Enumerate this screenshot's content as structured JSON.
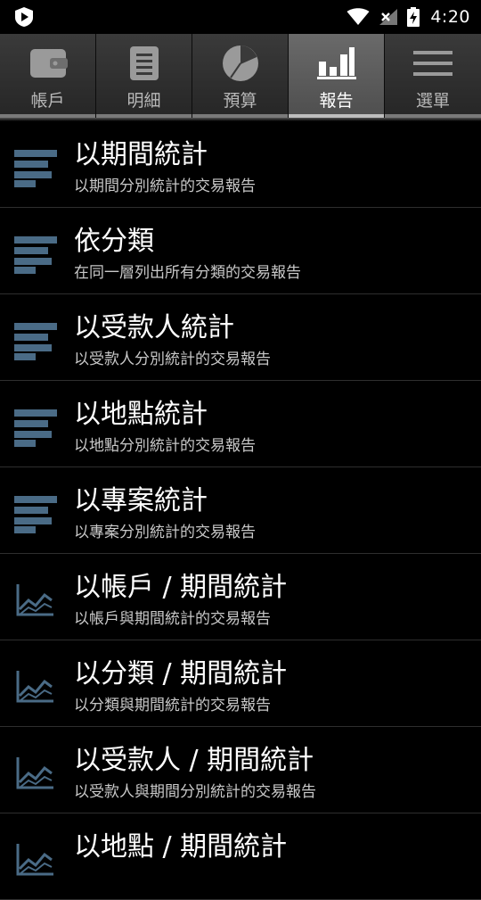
{
  "status_bar": {
    "time": "4:20"
  },
  "tabs": [
    {
      "label": "帳戶",
      "icon": "wallet-icon",
      "active": false
    },
    {
      "label": "明細",
      "icon": "document-icon",
      "active": false
    },
    {
      "label": "預算",
      "icon": "pie-chart-icon",
      "active": false
    },
    {
      "label": "報告",
      "icon": "bar-chart-icon",
      "active": true
    },
    {
      "label": "選單",
      "icon": "menu-icon",
      "active": false
    }
  ],
  "reports": [
    {
      "title": "以期間統計",
      "subtitle": "以期間分別統計的交易報告",
      "icon": "horizontal-bars-icon"
    },
    {
      "title": "依分類",
      "subtitle": "在同一層列出所有分類的交易報告",
      "icon": "horizontal-bars-icon"
    },
    {
      "title": "以受款人統計",
      "subtitle": "以受款人分別統計的交易報告",
      "icon": "horizontal-bars-icon"
    },
    {
      "title": "以地點統計",
      "subtitle": "以地點分別統計的交易報告",
      "icon": "horizontal-bars-icon"
    },
    {
      "title": "以專案統計",
      "subtitle": "以專案分別統計的交易報告",
      "icon": "horizontal-bars-icon"
    },
    {
      "title": "以帳戶 / 期間統計",
      "subtitle": "以帳戶與期間統計的交易報告",
      "icon": "line-chart-icon"
    },
    {
      "title": "以分類 / 期間統計",
      "subtitle": "以分類與期間統計的交易報告",
      "icon": "line-chart-icon"
    },
    {
      "title": "以受款人 / 期間統計",
      "subtitle": "以受款人與期間分別統計的交易報告",
      "icon": "line-chart-icon"
    },
    {
      "title": "以地點 / 期間統計",
      "subtitle": "",
      "icon": "line-chart-icon"
    }
  ]
}
